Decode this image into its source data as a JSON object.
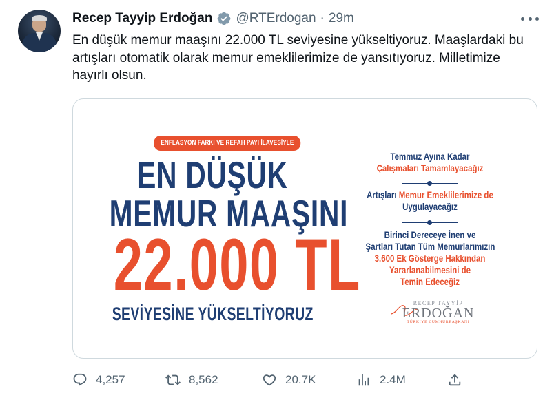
{
  "tweet": {
    "author_name": "Recep Tayyip Erdoğan",
    "handle": "@RTErdogan",
    "separator": "·",
    "time": "29m",
    "text": "En düşük memur maaşını 22.000 TL seviyesine yükseltiyoruz. Maaşlardaki bu artışları otomatik olarak memur emeklilerimize de yansıtıyoruz. Milletimize hayırlı olsun."
  },
  "media": {
    "pill_text": "ENFLASYON FARKI VE REFAH PAYI İLAVESİYLE",
    "headline_1": "EN DÜŞÜK",
    "headline_2": "MEMUR MAAŞINI",
    "amount": "22.000 TL",
    "sub": "SEVİYESİNE YÜKSELTİYORUZ",
    "point1_line1": "Temmuz Ayına Kadar",
    "point1_line2": "Çalışmaları Tamamlayacağız",
    "point2_line1_a": "Artışları ",
    "point2_line1_b": "Memur Emeklilerimize de",
    "point2_line2": "Uygulayacağız",
    "point3_line1": "Birinci Dereceye İnen ve",
    "point3_line2": "Şartları Tutan Tüm Memurlarımızın",
    "point3_line3": "3.600 Ek Gösterge Hakkından",
    "point3_line4": "Yararlanabilmesini de",
    "point3_line5": "Temin Edeceğiz",
    "signature_small": "RECEP TAYYİP",
    "signature_big": "ERDOĞAN",
    "signature_tiny": "TÜRKİYE CUMHURBAŞKANI"
  },
  "actions": {
    "replies": "4,257",
    "retweets": "8,562",
    "likes": "20.7K",
    "views": "2.4M"
  },
  "colors": {
    "navy": "#1f3e73",
    "orange": "#e8502e",
    "verified_badge": "#829aab",
    "muted_text": "#536471"
  },
  "icons": [
    "verified-badge-icon",
    "more-options-icon",
    "reply-icon",
    "retweet-icon",
    "like-icon",
    "views-icon",
    "share-icon"
  ]
}
